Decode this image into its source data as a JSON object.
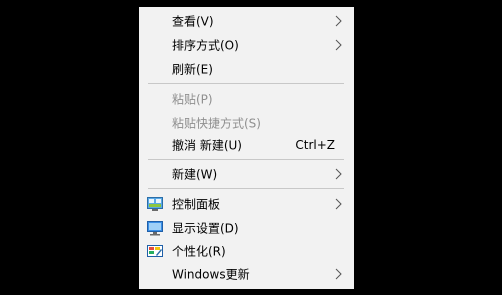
{
  "menu": {
    "items": [
      {
        "label": "查看(V)",
        "has_submenu": true,
        "disabled": false
      },
      {
        "label": "排序方式(O)",
        "has_submenu": true,
        "disabled": false
      },
      {
        "label": "刷新(E)",
        "has_submenu": false,
        "disabled": false
      },
      {
        "label": "粘贴(P)",
        "has_submenu": false,
        "disabled": true
      },
      {
        "label": "粘贴快捷方式(S)",
        "has_submenu": false,
        "disabled": true
      },
      {
        "label": "撤消 新建(U)",
        "shortcut": "Ctrl+Z",
        "has_submenu": false,
        "disabled": false
      },
      {
        "label": "新建(W)",
        "has_submenu": true,
        "disabled": false
      },
      {
        "label": "控制面板",
        "icon": "control-panel-icon",
        "has_submenu": true,
        "disabled": false
      },
      {
        "label": "显示设置(D)",
        "icon": "display-settings-icon",
        "has_submenu": false,
        "disabled": false
      },
      {
        "label": "个性化(R)",
        "icon": "personalize-icon",
        "has_submenu": false,
        "disabled": false
      },
      {
        "label": "Windows更新",
        "has_submenu": true,
        "disabled": false
      }
    ]
  },
  "colors": {
    "background": "#000000",
    "menu_bg": "#f2f2f2",
    "disabled_text": "#8f8f8f",
    "separator": "#c8c8c8"
  }
}
